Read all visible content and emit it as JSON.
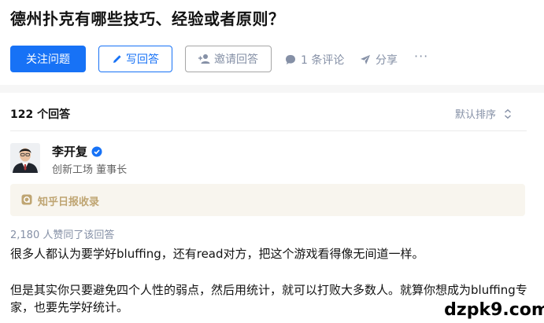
{
  "question": {
    "title": "德州扑克有哪些技巧、经验或者原则？"
  },
  "actions": {
    "follow_label": "关注问题",
    "write_label": "写回答",
    "invite_label": "邀请回答",
    "comment_label": "1 条评论",
    "share_label": "分享",
    "more_label": "···"
  },
  "answers": {
    "count_label": "122 个回答",
    "sort_label": "默认排序"
  },
  "answer": {
    "author_name": "李开复",
    "author_bio": "创新工场 董事长",
    "badge_label": "知乎日报收录",
    "votes_label": "2,180 人赞同了该回答",
    "paragraphs": [
      "很多人都认为要学好bluffing，还有read对方，把这个游戏看得像无间道一样。",
      "但是其实你只要避免四个人性的弱点，然后用统计，就可以打败大多数人。就算你想成为bluffing专家，也要先学好统计。"
    ]
  },
  "watermark": "dzpk9.com",
  "colors": {
    "accent": "#1772f6",
    "muted": "#8590a6",
    "badge_bg": "#f8f5ee",
    "badge_text": "#bfa572"
  },
  "icons": [
    "pencil-icon",
    "invite-user-icon",
    "comment-icon",
    "share-icon",
    "more-icon",
    "sort-icon",
    "verified-icon",
    "daily-badge-icon"
  ]
}
